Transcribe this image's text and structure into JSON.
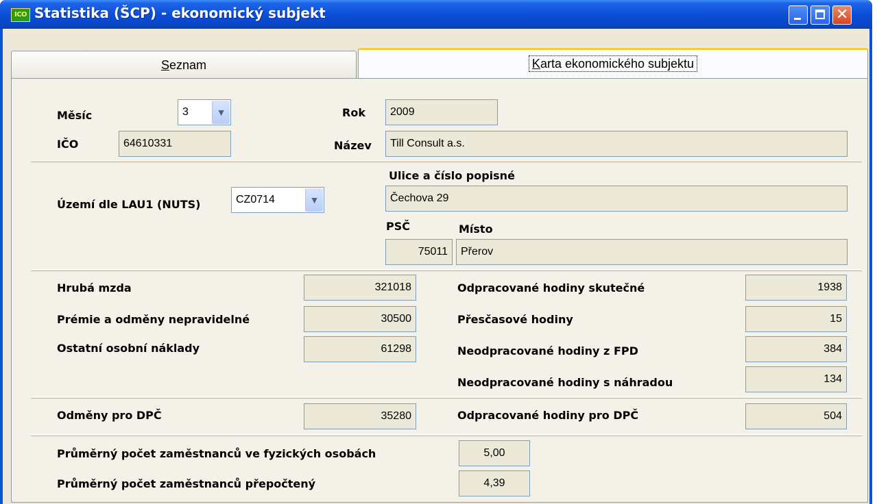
{
  "window": {
    "title": "Statistika (ŠCP) - ekonomický subjekt",
    "icon_text": "ICO",
    "close_glyph": "✕"
  },
  "tabs": [
    {
      "label_ul": "S",
      "label_rest": "eznam"
    },
    {
      "label_ul": "K",
      "label_rest": "arta ekonomického subjektu"
    }
  ],
  "header": {
    "mesic_label": "Měsíc",
    "mesic_value": "3",
    "rok_label": "Rok",
    "rok_value": "2009",
    "ico_label": "IČO",
    "ico_value": "64610331",
    "nazev_label": "Název",
    "nazev_value": "Till Consult a.s."
  },
  "address": {
    "uzemi_label": "Území dle LAU1 (NUTS)",
    "uzemi_value": "CZ0714",
    "ulice_label": "Ulice a číslo popisné",
    "ulice_value": "Čechova 29",
    "psc_label": "PSČ",
    "psc_value": "75011",
    "misto_label": "Místo",
    "misto_value": "Přerov"
  },
  "wages": {
    "hruba_mzda_label": "Hrubá mzda",
    "hruba_mzda_value": "321018",
    "premie_label": "Prémie a odměny nepravidelné",
    "premie_value": "30500",
    "ostatni_label": "Ostatní osobní náklady",
    "ostatni_value": "61298",
    "hod_skutecne_label": "Odpracované hodiny skutečné",
    "hod_skutecne_value": "1938",
    "prescasove_label": "Přesčasové hodiny",
    "prescasove_value": "15",
    "neodprac_fpd_label": "Neodpracované hodiny z FPD",
    "neodprac_fpd_value": "384",
    "neodprac_nahrada_label": "Neodpracované hodiny s náhradou",
    "neodprac_nahrada_value": "134"
  },
  "dpc": {
    "odmeny_label": "Odměny pro DPČ",
    "odmeny_value": "35280",
    "hodiny_label": "Odpracované hodiny pro DPČ",
    "hodiny_value": "504"
  },
  "employees": {
    "fyzicke_label": "Průměrný počet zaměstnanců ve fyzických osobách",
    "fyzicke_value": "5,00",
    "prepocteny_label": "Průměrný počet zaměstnanců přepočtený",
    "prepocteny_value": "4,39"
  }
}
